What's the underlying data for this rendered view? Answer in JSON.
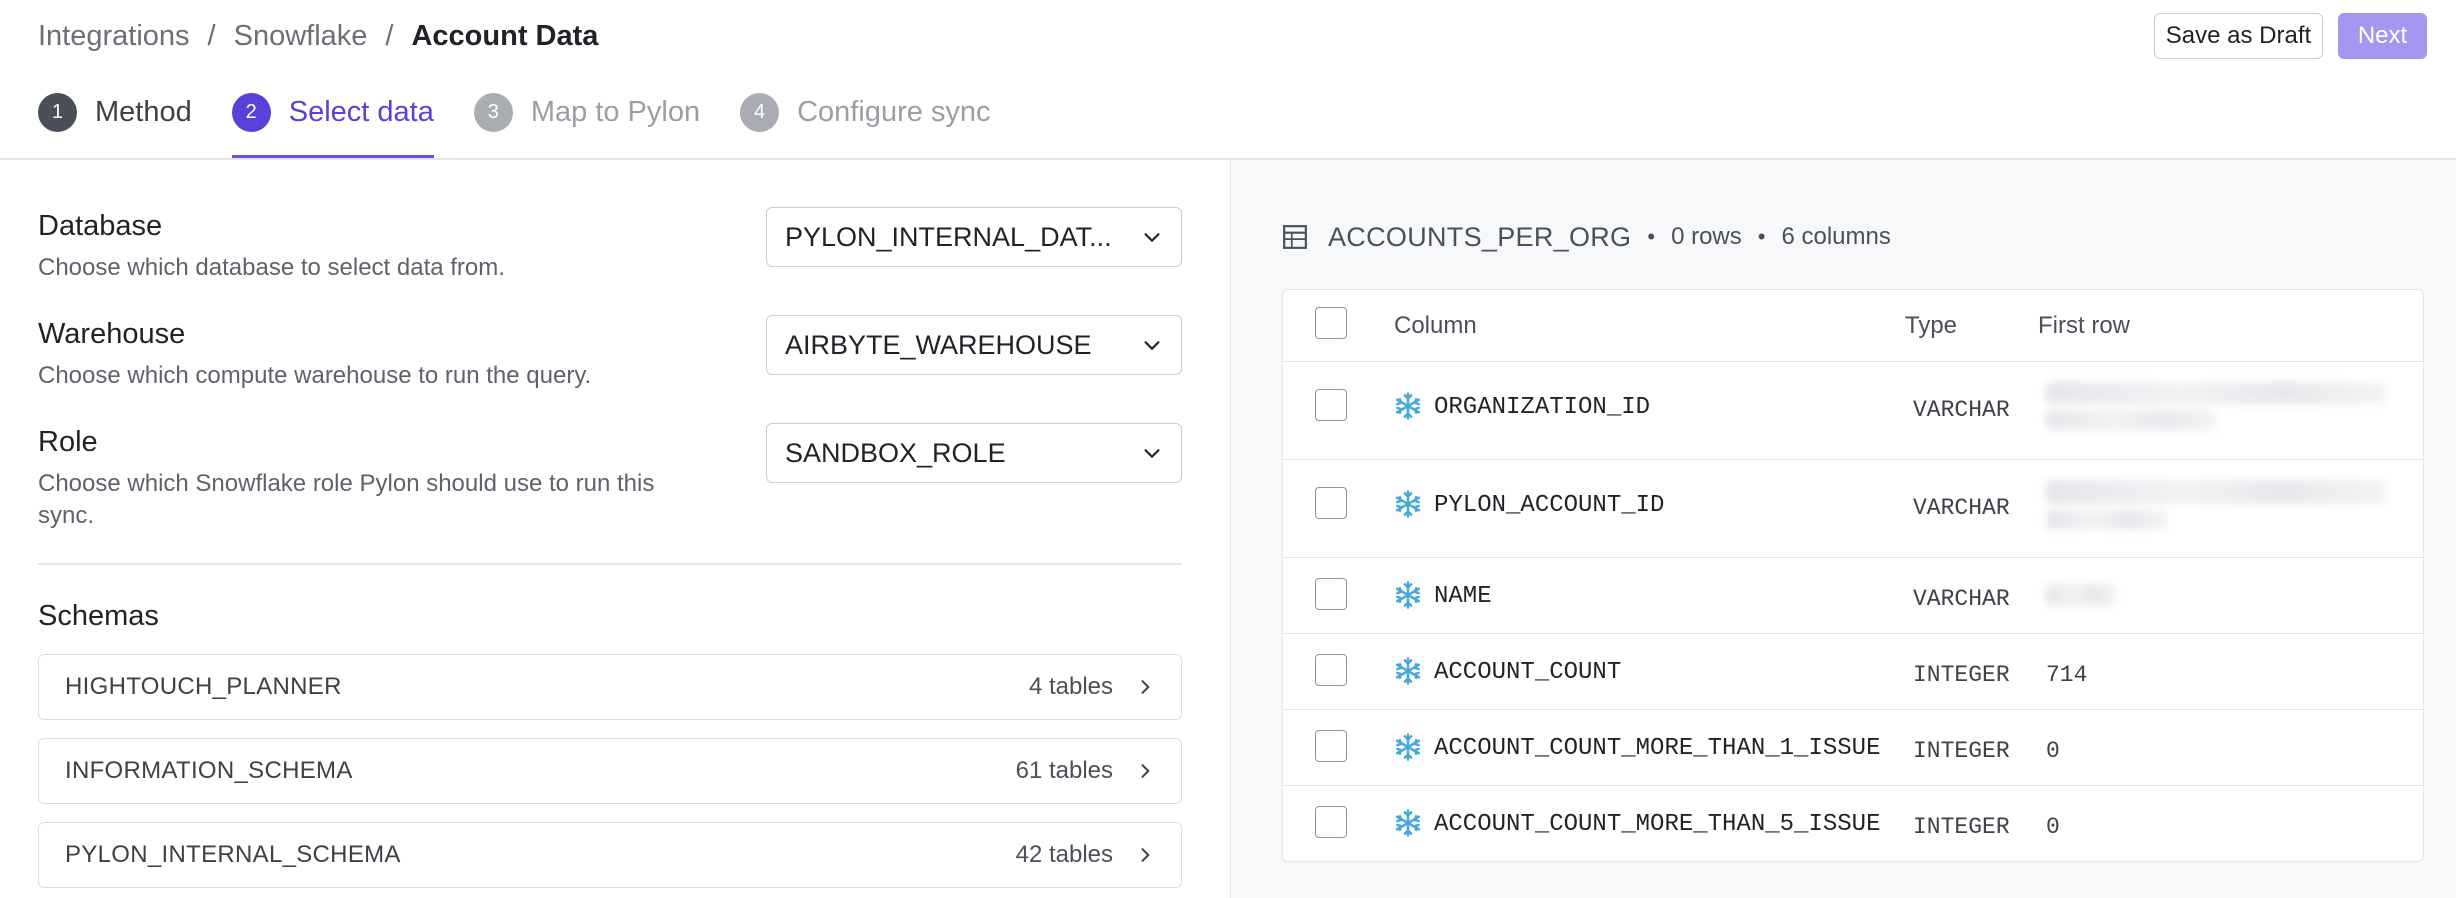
{
  "breadcrumb": {
    "items": [
      "Integrations",
      "Snowflake"
    ],
    "separator": "/",
    "current": "Account Data"
  },
  "actions": {
    "save_draft": "Save as Draft",
    "next": "Next"
  },
  "steps": [
    {
      "num": "1",
      "label": "Method",
      "state": "done"
    },
    {
      "num": "2",
      "label": "Select data",
      "state": "active"
    },
    {
      "num": "3",
      "label": "Map to Pylon",
      "state": "todo"
    },
    {
      "num": "4",
      "label": "Configure sync",
      "state": "todo"
    }
  ],
  "fields": {
    "database": {
      "title": "Database",
      "desc": "Choose which database to select data from.",
      "value": "PYLON_INTERNAL_DAT..."
    },
    "warehouse": {
      "title": "Warehouse",
      "desc": "Choose which compute warehouse to run the query.",
      "value": "AIRBYTE_WAREHOUSE"
    },
    "role": {
      "title": "Role",
      "desc": "Choose which Snowflake role Pylon should use to run this sync.",
      "value": "SANDBOX_ROLE"
    }
  },
  "schemas": {
    "title": "Schemas",
    "items": [
      {
        "name": "HIGHTOUCH_PLANNER",
        "count": "4 tables"
      },
      {
        "name": "INFORMATION_SCHEMA",
        "count": "61 tables"
      },
      {
        "name": "PYLON_INTERNAL_SCHEMA",
        "count": "42 tables"
      }
    ]
  },
  "table": {
    "name": "ACCOUNTS_PER_ORG",
    "bullet": "•",
    "rows_meta": "0 rows",
    "cols_meta": "6 columns",
    "headers": {
      "column": "Column",
      "type": "Type",
      "first_row": "First row"
    },
    "columns": [
      {
        "name": "ORGANIZATION_ID",
        "type": "VARCHAR",
        "first": ""
      },
      {
        "name": "PYLON_ACCOUNT_ID",
        "type": "VARCHAR",
        "first": ""
      },
      {
        "name": "NAME",
        "type": "VARCHAR",
        "first": ""
      },
      {
        "name": "ACCOUNT_COUNT",
        "type": "INTEGER",
        "first": "714"
      },
      {
        "name": "ACCOUNT_COUNT_MORE_THAN_1_ISSUE",
        "type": "INTEGER",
        "first": "0"
      },
      {
        "name": "ACCOUNT_COUNT_MORE_THAN_5_ISSUE",
        "type": "INTEGER",
        "first": "0"
      }
    ]
  },
  "colors": {
    "accent": "#5b3fd9",
    "next_button": "#a796f0",
    "snowflake_icon": "#4aa8d8"
  },
  "icons": {
    "select": "chevron-down-icon",
    "schema_row": "chevron-right-icon",
    "table": "table-grid-icon",
    "column": "snowflake-icon"
  }
}
